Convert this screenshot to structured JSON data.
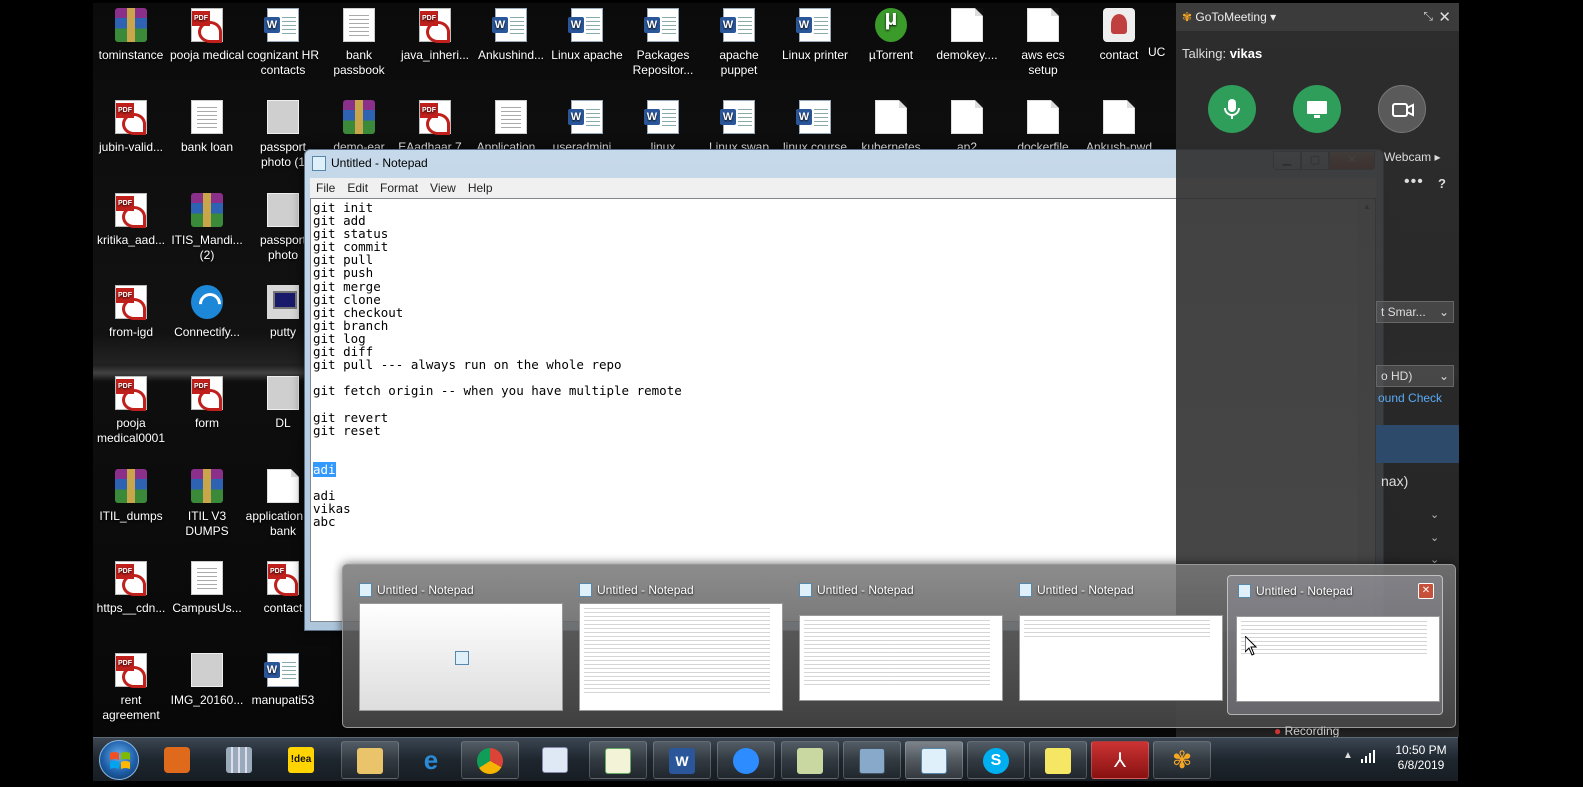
{
  "desktop": {
    "icons": [
      {
        "label": "tominstance",
        "kind": "rar",
        "col": 0,
        "row": 0
      },
      {
        "label": "pooja medical",
        "kind": "pdf",
        "col": 1,
        "row": 0
      },
      {
        "label": "cognizant HR contacts",
        "kind": "word",
        "col": 2,
        "row": 0
      },
      {
        "label": "bank passbook",
        "kind": "doc",
        "col": 3,
        "row": 0
      },
      {
        "label": "java_inheri...",
        "kind": "pdf",
        "col": 4,
        "row": 0
      },
      {
        "label": "Ankushind...",
        "kind": "word",
        "col": 5,
        "row": 0
      },
      {
        "label": "Linux apache",
        "kind": "word",
        "col": 6,
        "row": 0
      },
      {
        "label": "Packages Repositor...",
        "kind": "word",
        "col": 7,
        "row": 0
      },
      {
        "label": "apache puppet",
        "kind": "word",
        "col": 8,
        "row": 0
      },
      {
        "label": "Linux printer",
        "kind": "word",
        "col": 9,
        "row": 0
      },
      {
        "label": "µTorrent",
        "kind": "torrent",
        "col": 10,
        "row": 0
      },
      {
        "label": "demokey....",
        "kind": "blank",
        "col": 11,
        "row": 0
      },
      {
        "label": "aws ecs setup",
        "kind": "blank",
        "col": 12,
        "row": 0
      },
      {
        "label": "contact",
        "kind": "contact",
        "col": 13,
        "row": 0
      },
      {
        "label": "jubin-valid...",
        "kind": "pdf",
        "col": 0,
        "row": 1
      },
      {
        "label": "bank loan",
        "kind": "doc",
        "col": 1,
        "row": 1
      },
      {
        "label": "passport photo (1",
        "kind": "img",
        "col": 2,
        "row": 1
      },
      {
        "label": "demo-ear",
        "kind": "rar",
        "col": 3,
        "row": 1
      },
      {
        "label": "EAadhaar 7...",
        "kind": "pdf",
        "col": 4,
        "row": 1
      },
      {
        "label": "Application...",
        "kind": "doc",
        "col": 5,
        "row": 1
      },
      {
        "label": "useradmini...",
        "kind": "word",
        "col": 6,
        "row": 1
      },
      {
        "label": "linux",
        "kind": "word",
        "col": 7,
        "row": 1
      },
      {
        "label": "Linux swap",
        "kind": "word",
        "col": 8,
        "row": 1
      },
      {
        "label": "linux course",
        "kind": "word",
        "col": 9,
        "row": 1
      },
      {
        "label": "kubernetes",
        "kind": "blank",
        "col": 10,
        "row": 1
      },
      {
        "label": "ap2",
        "kind": "blank",
        "col": 11,
        "row": 1
      },
      {
        "label": "dockerfile",
        "kind": "blank",
        "col": 12,
        "row": 1
      },
      {
        "label": "Ankush-pwd",
        "kind": "blank",
        "col": 13,
        "row": 1
      },
      {
        "label": "kritika_aad...",
        "kind": "pdf",
        "col": 0,
        "row": 2
      },
      {
        "label": "ITIS_Mandi... (2)",
        "kind": "rar",
        "col": 1,
        "row": 2
      },
      {
        "label": "passport photo",
        "kind": "img",
        "col": 2,
        "row": 2
      },
      {
        "label": "from-igd",
        "kind": "pdf",
        "col": 0,
        "row": 3
      },
      {
        "label": "Connectify...",
        "kind": "wifi",
        "col": 1,
        "row": 3
      },
      {
        "label": "putty",
        "kind": "putty",
        "col": 2,
        "row": 3
      },
      {
        "label": "pooja medical0001",
        "kind": "pdf",
        "col": 0,
        "row": 4
      },
      {
        "label": "form",
        "kind": "pdf",
        "col": 1,
        "row": 4
      },
      {
        "label": "DL",
        "kind": "img",
        "col": 2,
        "row": 4
      },
      {
        "label": "ITIL_dumps",
        "kind": "rar",
        "col": 0,
        "row": 5
      },
      {
        "label": "ITIL V3 DUMPS",
        "kind": "rar",
        "col": 1,
        "row": 5
      },
      {
        "label": "application for bank",
        "kind": "blank",
        "col": 2,
        "row": 5
      },
      {
        "label": "https__cdn...",
        "kind": "pdf",
        "col": 0,
        "row": 6
      },
      {
        "label": "CampusUs...",
        "kind": "doc",
        "col": 1,
        "row": 6
      },
      {
        "label": "contact",
        "kind": "pdf",
        "col": 2,
        "row": 6
      },
      {
        "label": "rent agreement",
        "kind": "pdf",
        "col": 0,
        "row": 7
      },
      {
        "label": "IMG_20160...",
        "kind": "img",
        "col": 1,
        "row": 7
      },
      {
        "label": "manupati53",
        "kind": "word",
        "col": 2,
        "row": 7
      }
    ],
    "partial_label_uc": "UC"
  },
  "notepad": {
    "title": "Untitled - Notepad",
    "menu": [
      "File",
      "Edit",
      "Format",
      "View",
      "Help"
    ],
    "lines_before": "git init\ngit add\ngit status\ngit commit\ngit pull\ngit push\ngit merge\ngit clone\ngit checkout\ngit branch\ngit log\ngit diff\ngit pull --- always run on the whole repo\n\ngit fetch origin -- when you have multiple remote\n\ngit revert\ngit reset\n\n\n",
    "selected": "adi",
    "lines_after": "\n\nadi\nvikas\nabc"
  },
  "gotomeeting": {
    "app_name": "GoToMeeting",
    "talking_label": "Talking:",
    "talking_name": "vikas",
    "webcam_label": "Webcam",
    "device_select_1": "t Smar...",
    "device_select_2": "o HD)",
    "sound_check": "ound Check",
    "max_text": "nax)",
    "recording_label": "Recording",
    "colors": {
      "green": "#2e9e5a",
      "panel": "#303030",
      "link": "#5aaaf5"
    }
  },
  "thumbnails": {
    "items": [
      {
        "title": "Untitled - Notepad"
      },
      {
        "title": "Untitled - Notepad"
      },
      {
        "title": "Untitled - Notepad"
      },
      {
        "title": "Untitled - Notepad"
      },
      {
        "title": "Untitled - Notepad"
      }
    ]
  },
  "taskbar": {
    "apps": [
      "windows-media-player",
      "calculator",
      "idea",
      "windows-explorer",
      "internet-explorer",
      "chrome",
      "file-manager",
      "notepad-plus-plus",
      "word",
      "zoom",
      "folder",
      "virtualbox",
      "notepad",
      "skype",
      "sticky-notes",
      "acrobat",
      "gotomeeting"
    ],
    "idea_label": "!dea",
    "time": "10:50 PM",
    "date": "6/8/2019"
  }
}
